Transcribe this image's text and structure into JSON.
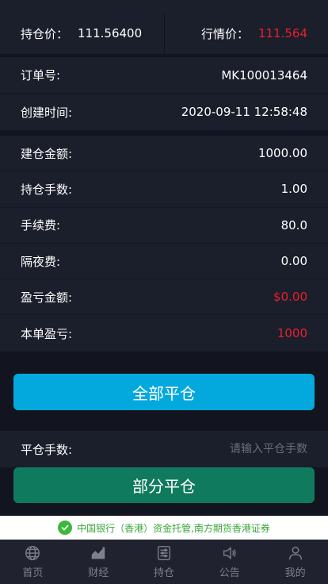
{
  "price_bar": {
    "hold_price_label": "持仓价：",
    "hold_price_value": "111.56400",
    "market_price_label": "行情价：",
    "market_price_value": "111.564"
  },
  "order": {
    "order_no_label": "订单号:",
    "order_no_value": "MK100013464",
    "created_label": "创建时间:",
    "created_value": "2020-09-11 12:58:48"
  },
  "details": [
    {
      "label": "建仓金额:",
      "value": "1000.00",
      "color": "#ffffff"
    },
    {
      "label": "持仓手数:",
      "value": "1.00",
      "color": "#ffffff"
    },
    {
      "label": "手续费:",
      "value": "80.0",
      "color": "#ffffff"
    },
    {
      "label": "隔夜费:",
      "value": "0.00",
      "color": "#ffffff"
    },
    {
      "label": "盈亏金额:",
      "value": "$0.00",
      "color": "#e8202a"
    },
    {
      "label": "本单盈亏:",
      "value": "1000",
      "color": "#e8202a"
    }
  ],
  "buttons": {
    "close_all": "全部平仓",
    "partial_close": "部分平仓"
  },
  "quantity": {
    "label": "平仓手数:",
    "placeholder": "请输入平仓手数"
  },
  "banner": {
    "text": "中国银行（香港）资金托管,南方期货香港证券"
  },
  "tabbar": [
    {
      "label": "首页",
      "icon": "globe-icon"
    },
    {
      "label": "财经",
      "icon": "chart-icon"
    },
    {
      "label": "持仓",
      "icon": "position-icon"
    },
    {
      "label": "公告",
      "icon": "speaker-icon"
    },
    {
      "label": "我的",
      "icon": "user-icon"
    }
  ],
  "colors": {
    "accent_blue": "#03a9dd",
    "accent_green": "#0f7a5e",
    "loss_red": "#e8202a",
    "background": "#12151f",
    "panel": "#1b1e2b"
  }
}
